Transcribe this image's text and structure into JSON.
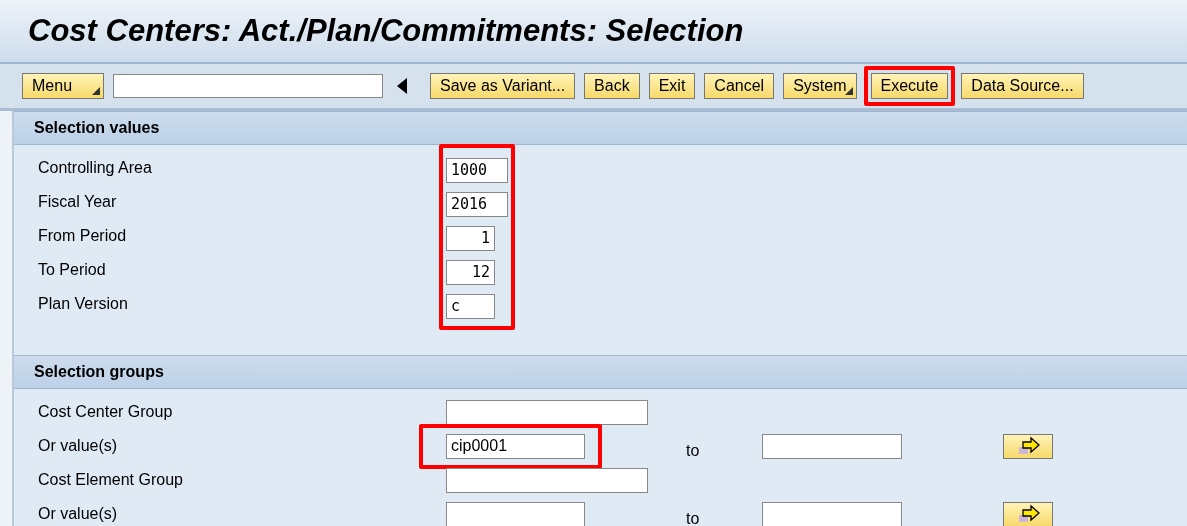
{
  "title": "Cost Centers: Act./Plan/Commitments: Selection",
  "toolbar": {
    "menu": {
      "label": "Menu",
      "dropdown": true
    },
    "buttons": [
      {
        "label": "Save as Variant...",
        "dropdown": false,
        "highlighted": false
      },
      {
        "label": "Back",
        "dropdown": false,
        "highlighted": false
      },
      {
        "label": "Exit",
        "dropdown": false,
        "highlighted": false
      },
      {
        "label": "Cancel",
        "dropdown": false,
        "highlighted": false
      },
      {
        "label": "System",
        "dropdown": true,
        "highlighted": false
      },
      {
        "label": "Execute",
        "dropdown": false,
        "highlighted": true
      },
      {
        "label": "Data Source...",
        "dropdown": false,
        "highlighted": false
      }
    ]
  },
  "selection_values": {
    "title": "Selection values",
    "highlighted": true,
    "rows": [
      {
        "label": "Controlling Area",
        "value": "1000",
        "kind": "code"
      },
      {
        "label": "Fiscal Year",
        "value": "2016",
        "kind": "code"
      },
      {
        "label": "From Period",
        "value": "1",
        "kind": "number"
      },
      {
        "label": "To Period",
        "value": "12",
        "kind": "number"
      },
      {
        "label": "Plan Version",
        "value": "c",
        "kind": "code"
      }
    ]
  },
  "selection_groups": {
    "title": "Selection groups",
    "rows": [
      {
        "kind": "group",
        "label": "Cost Center Group"
      },
      {
        "kind": "range",
        "label": "Or value(s)",
        "value": "cip0001",
        "highlighted": true,
        "to_label": "to"
      },
      {
        "kind": "group",
        "label": "Cost Element Group"
      },
      {
        "kind": "range",
        "label": "Or value(s)",
        "highlighted": false,
        "to_label": "to"
      }
    ]
  }
}
